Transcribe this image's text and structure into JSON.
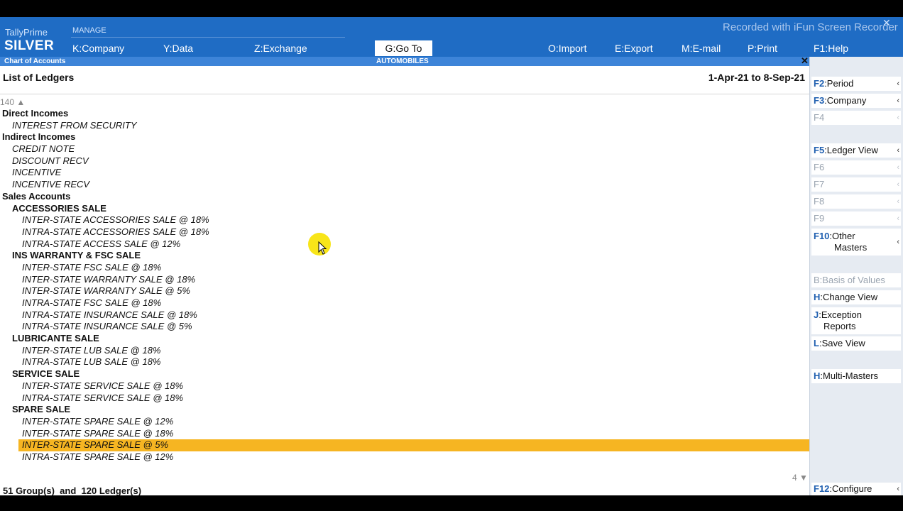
{
  "app": {
    "name": "TallyPrime",
    "edition": "SILVER",
    "manage_label": "MANAGE"
  },
  "recorder_text": "Recorded with iFun Screen Recorder",
  "menu": {
    "company": {
      "key": "K",
      "label": "Company"
    },
    "data": {
      "key": "Y",
      "label": "Data"
    },
    "exchange": {
      "key": "Z",
      "label": "Exchange"
    },
    "goto": {
      "key": "G",
      "label": "Go To"
    },
    "import": {
      "key": "O",
      "label": "Import"
    },
    "export": {
      "key": "E",
      "label": "Export"
    },
    "email": {
      "key": "M",
      "label": "E-mail"
    },
    "print": {
      "key": "P",
      "label": "Print"
    },
    "help": {
      "key": "F1",
      "label": "Help"
    }
  },
  "subheader": {
    "left": "Chart of Accounts",
    "center": "AUTOMOBILES"
  },
  "report": {
    "title": "List of Ledgers",
    "period": "1-Apr-21 to 8-Sep-21",
    "count_top": "140 ▲",
    "count_bottom": "4 ▼",
    "summary": "51 Group(s)  and  120 Ledger(s)"
  },
  "rows": [
    {
      "text": "Direct Incomes",
      "level": 0
    },
    {
      "text": "INTEREST FROM SECURITY",
      "level": 1,
      "type": "led"
    },
    {
      "text": "Indirect Incomes",
      "level": 0
    },
    {
      "text": "CREDIT NOTE",
      "level": 1,
      "type": "led"
    },
    {
      "text": "DISCOUNT RECV",
      "level": 1,
      "type": "led"
    },
    {
      "text": "INCENTIVE",
      "level": 1,
      "type": "led"
    },
    {
      "text": "INCENTIVE RECV",
      "level": 1,
      "type": "led"
    },
    {
      "text": "Sales Accounts",
      "level": 0
    },
    {
      "text": "ACCESSORIES SALE",
      "level": 1,
      "type": "grp"
    },
    {
      "text": "INTER-STATE ACCESSORIES SALE @ 18%",
      "level": 2
    },
    {
      "text": "INTRA-STATE ACCESSORIES SALE @ 18%",
      "level": 2
    },
    {
      "text": "INTRA-STATE ACCESS SALE @ 12%",
      "level": 2
    },
    {
      "text": "INS WARRANTY & FSC SALE",
      "level": 1,
      "type": "grp"
    },
    {
      "text": "INTER-STATE FSC SALE @ 18%",
      "level": 2
    },
    {
      "text": "INTER-STATE WARRANTY SALE @ 18%",
      "level": 2
    },
    {
      "text": "INTER-STATE WARRANTY SALE @ 5%",
      "level": 2
    },
    {
      "text": "INTRA-STATE FSC SALE @ 18%",
      "level": 2
    },
    {
      "text": "INTRA-STATE INSURANCE SALE @ 18%",
      "level": 2
    },
    {
      "text": "INTRA-STATE INSURANCE SALE @ 5%",
      "level": 2
    },
    {
      "text": "LUBRICANTE SALE",
      "level": 1,
      "type": "grp"
    },
    {
      "text": "INTER-STATE LUB SALE @ 18%",
      "level": 2
    },
    {
      "text": "INTRA-STATE LUB SALE @ 18%",
      "level": 2
    },
    {
      "text": "SERVICE SALE",
      "level": 1,
      "type": "grp"
    },
    {
      "text": "INTER-STATE SERVICE SALE @ 18%",
      "level": 2
    },
    {
      "text": "INTRA-STATE SERVICE SALE @ 18%",
      "level": 2
    },
    {
      "text": "SPARE SALE",
      "level": 1,
      "type": "grp"
    },
    {
      "text": "INTER-STATE SPARE SALE @ 12%",
      "level": 2
    },
    {
      "text": "INTER-STATE SPARE SALE @ 18%",
      "level": 2
    },
    {
      "text": "INTER-STATE SPARE SALE @ 5%",
      "level": 2,
      "selected": true
    },
    {
      "text": "INTRA-STATE SPARE SALE @ 12%",
      "level": 2
    }
  ],
  "right_panel": {
    "f2": {
      "key": "F2",
      "label": "Period"
    },
    "f3": {
      "key": "F3",
      "label": "Company"
    },
    "f4": {
      "key": "F4",
      "label": ""
    },
    "f5": {
      "key": "F5",
      "label": "Ledger View"
    },
    "f6": {
      "key": "F6",
      "label": ""
    },
    "f7": {
      "key": "F7",
      "label": ""
    },
    "f8": {
      "key": "F8",
      "label": ""
    },
    "f9": {
      "key": "F9",
      "label": ""
    },
    "f10": {
      "key": "F10",
      "label": "Other",
      "label2": "Masters"
    },
    "b": {
      "key": "B",
      "label": "Basis of Values"
    },
    "h_change": {
      "key": "H",
      "label": "Change View"
    },
    "j": {
      "key": "J",
      "label": "Exception",
      "label2": "Reports"
    },
    "l": {
      "key": "L",
      "label": "Save View"
    },
    "h_multi": {
      "key": "H",
      "label": "Multi-Masters"
    },
    "f12": {
      "key": "F12",
      "label": "Configure"
    }
  },
  "colors": {
    "topbar": "#1f6cc4",
    "subbar": "#3d84d8",
    "selection": "#f6b522",
    "cursor_highlight": "#f7e200"
  }
}
